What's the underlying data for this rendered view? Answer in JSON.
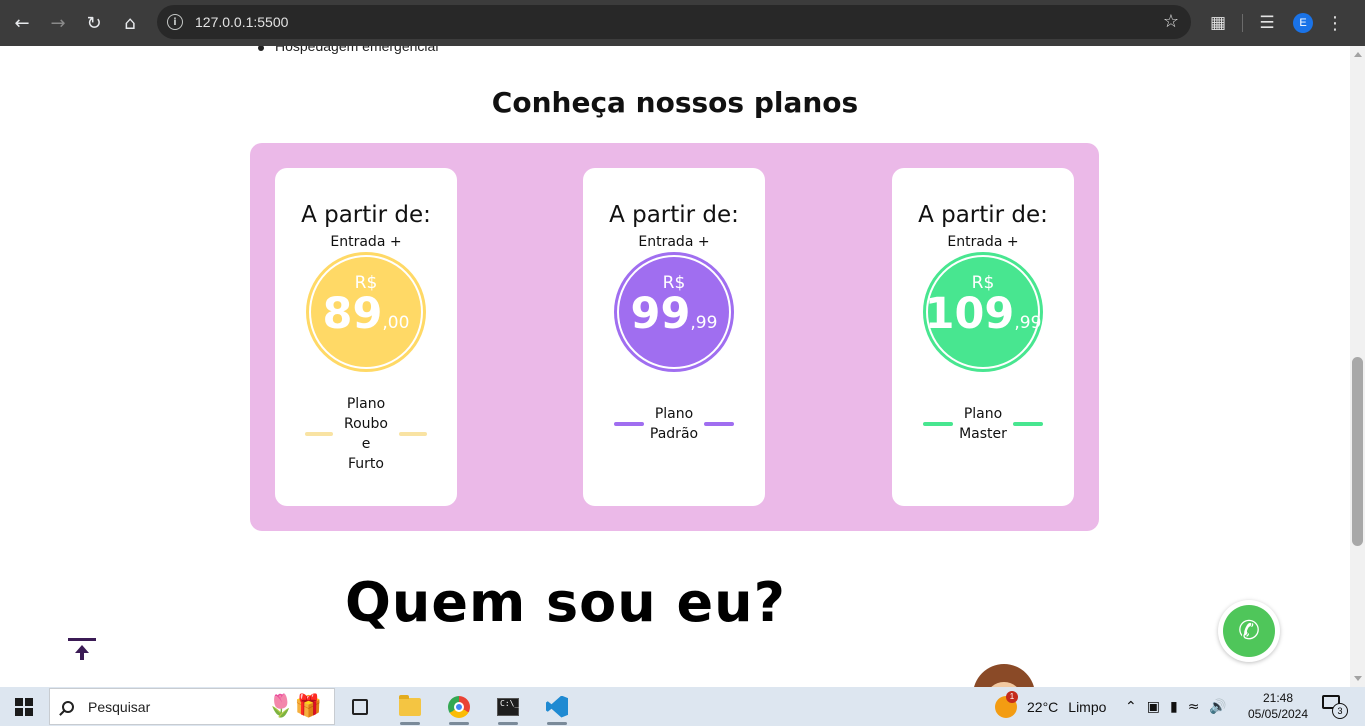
{
  "browser": {
    "url": "127.0.0.1:5500",
    "profile_initial": "E"
  },
  "page": {
    "partial_bullet": "Hospedagem emergencial",
    "section_title": "Conheça nossos planos",
    "plans": [
      {
        "from_label": "A partir de:",
        "entry_label": "Entrada +",
        "currency": "R$",
        "amount": "89",
        "cents": ",00",
        "plan_name_lines": [
          "Plano",
          "Roubo e",
          "Furto"
        ],
        "color": "#ffd966",
        "line_color": "#f9e3a3"
      },
      {
        "from_label": "A partir de:",
        "entry_label": "Entrada +",
        "currency": "R$",
        "amount": "99",
        "cents": ",99",
        "plan_name_lines": [
          "Plano",
          "Padrão"
        ],
        "color": "#a06ef0",
        "line_color": "#a06ef0"
      },
      {
        "from_label": "A partir de:",
        "entry_label": "Entrada +",
        "currency": "R$",
        "amount": "109",
        "cents": ",99",
        "plan_name_lines": [
          "Plano",
          "Master"
        ],
        "color": "#48e690",
        "line_color": "#48e690"
      }
    ],
    "about_title": "Quem sou eu?"
  },
  "taskbar": {
    "search_placeholder": "Pesquisar",
    "weather_temp": "22°C",
    "weather_condition": "Limpo",
    "weather_badge": "1",
    "time": "21:48",
    "date": "05/05/2024",
    "notification_count": "3"
  }
}
